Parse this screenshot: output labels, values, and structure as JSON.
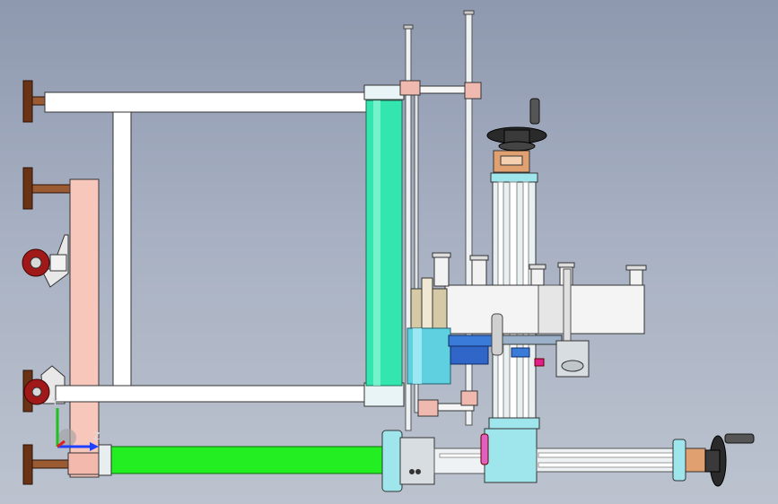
{
  "viewport": {
    "background_top": "#8e98ae",
    "background_bottom": "#bcc3cf"
  },
  "model": {
    "frame_color": "#ffffff",
    "roller_color": "#33e6b0",
    "column_color": "#e8f0f2",
    "base_color": "#f8c7bc",
    "feed_tube_color": "#22ee22",
    "label_drum_color": "#5fd0e0",
    "bracket_color": "#f0b9b0",
    "handwheel_color": "#2a2a2a",
    "foot_color": "#7a3a1a"
  },
  "triad": {
    "x_label": "",
    "y_label": "Y",
    "z_label": "Z",
    "x_color": "#e02020",
    "y_color": "#20c020",
    "z_color": "#2040ff"
  }
}
